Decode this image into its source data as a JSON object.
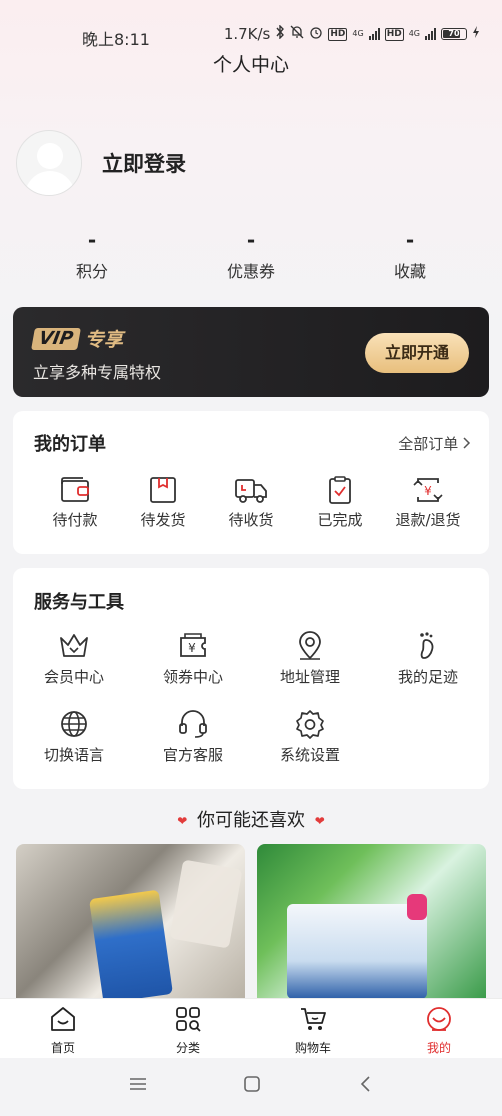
{
  "status_bar": {
    "time": "晚上8:11",
    "network_speed": "1.7K/s",
    "hd1": "HD",
    "hd2": "HD",
    "net1": "4G",
    "net2": "4G",
    "battery": "70"
  },
  "header": {
    "title": "个人中心"
  },
  "profile": {
    "login_label": "立即登录"
  },
  "stats": [
    {
      "value": "-",
      "label": "积分"
    },
    {
      "value": "-",
      "label": "优惠券"
    },
    {
      "value": "-",
      "label": "收藏"
    }
  ],
  "vip": {
    "badge": "VIP",
    "title": "专享",
    "subtitle": "立享多种专属特权",
    "button": "立即开通"
  },
  "orders": {
    "title": "我的订单",
    "all_link": "全部订单",
    "items": [
      {
        "label": "待付款",
        "icon": "wallet-icon"
      },
      {
        "label": "待发货",
        "icon": "package-icon"
      },
      {
        "label": "待收货",
        "icon": "truck-icon"
      },
      {
        "label": "已完成",
        "icon": "clipboard-check-icon"
      },
      {
        "label": "退款/退货",
        "icon": "refund-icon"
      }
    ]
  },
  "tools": {
    "title": "服务与工具",
    "items": [
      {
        "label": "会员中心",
        "icon": "crown-icon"
      },
      {
        "label": "领券中心",
        "icon": "coupon-icon"
      },
      {
        "label": "地址管理",
        "icon": "location-icon"
      },
      {
        "label": "我的足迹",
        "icon": "footprint-icon"
      },
      {
        "label": "切换语言",
        "icon": "globe-icon"
      },
      {
        "label": "官方客服",
        "icon": "headset-icon"
      },
      {
        "label": "系统设置",
        "icon": "gear-icon"
      }
    ]
  },
  "recommend": {
    "title": "你可能还喜欢"
  },
  "tabbar": {
    "items": [
      {
        "label": "首页",
        "icon": "home-icon",
        "active": false
      },
      {
        "label": "分类",
        "icon": "category-icon",
        "active": false
      },
      {
        "label": "购物车",
        "icon": "cart-icon",
        "active": false
      },
      {
        "label": "我的",
        "icon": "profile-icon",
        "active": true
      }
    ],
    "active_color": "#e02e2e"
  },
  "colors": {
    "vip_gold": "#e0bb83",
    "vip_bg": "#1d1c1e",
    "heart": "#e23b3b"
  }
}
